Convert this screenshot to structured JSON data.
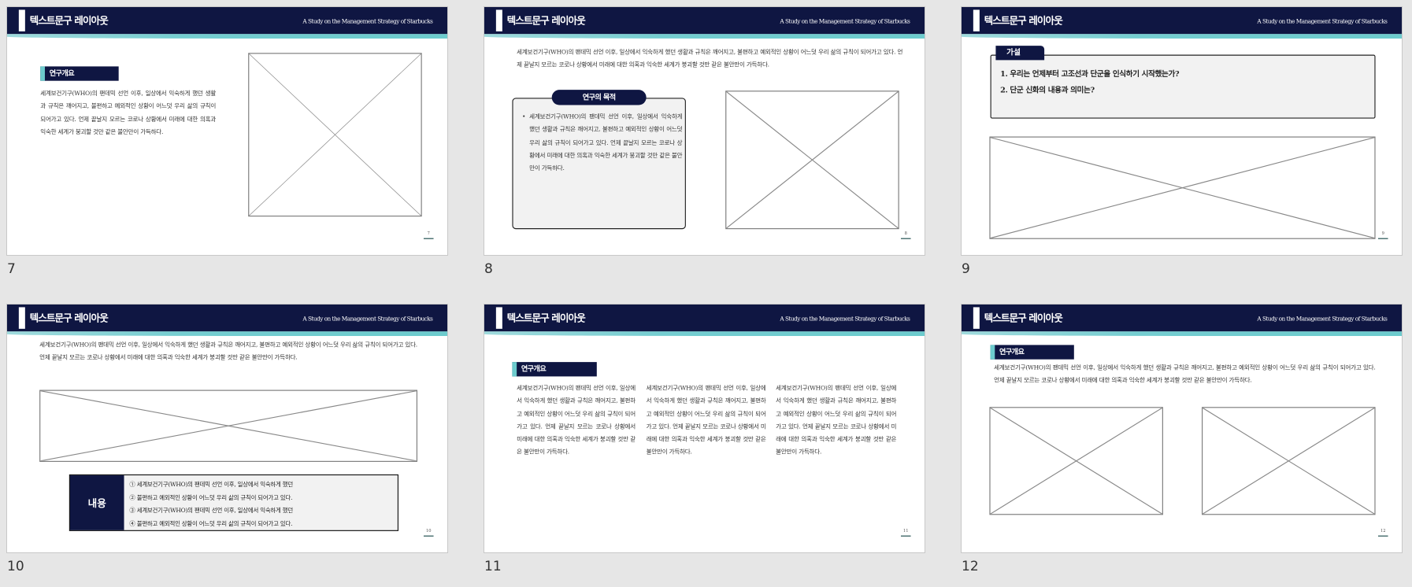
{
  "header": {
    "title": "텍스트문구 레이아웃",
    "subtitle": "A Study on the Management Strategy of Starbucks"
  },
  "slides": [
    {
      "number": "7",
      "page": "7",
      "label": "연구개요",
      "body": "세계보건기구(WHO)의 팬데믹 선언 이후, 일상에서 익숙하게 했던 생활과 규칙은 깨어지고, 불편하고 예외적인 상황이 어느덧 우리 삶의 규칙이 되어가고 있다. 언제 끝날지 모르는 코로나 상황에서 미래에 대한 의혹과 익숙한 세계가 붕괴할 것만 같은 불안만이 가득하다."
    },
    {
      "number": "8",
      "page": "8",
      "body": "세계보건기구(WHO)의 팬데믹 선언 이후, 일상에서 익숙하게 했던 생활과 규칙은 깨어지고, 불편하고 예외적인 상황이 어느덧 우리 삶의 규칙이 되어가고 있다. 언제 끝날지 모르는 코로나 상황에서 미래에 대한 의혹과 익숙한 세계가 붕괴할 것만 같은 불안만이 가득하다.",
      "box_title": "연구의 목적",
      "box_body": "세계보건기구(WHO)의 팬데믹 선언 이후, 일상에서 익숙하게 했던 생활과 규칙은 깨어지고, 불편하고 예외적인 상황이 어느덧 우리 삶의 규칙이 되어가고 있다. 언제 끝날지 모르는 코로나 상황에서 미래에 대한 의혹과 익숙한 세계가 붕괴할 것만 같은 불안만이 가득하다."
    },
    {
      "number": "9",
      "page": "9",
      "tab": "가설",
      "lines": [
        "1. 우리는 언제부터 고조선과 단군을 인식하기 시작했는가?",
        "2. 단군 신화의 내용과 의미는?"
      ]
    },
    {
      "number": "10",
      "page": "10",
      "body": "세계보건기구(WHO)의 팬데믹 선언 이후, 일상에서 익숙하게 했던 생활과 규칙은 깨어지고, 불편하고 예외적인 상황이 어느덧 우리 삶의 규칙이 되어가고 있다. 언제 끝날지 모르는 코로나 상황에서 미래에 대한 의혹과 익숙한 세계가 붕괴할 것만 같은 불안만이 가득하다.",
      "content_label": "내용",
      "items": [
        "①  세계보건기구(WHO)의 팬데믹 선언 이후, 일상에서 익숙하게 했던",
        "②  불편하고 예외적인 상황이 어느덧 우리 삶의 규칙이 되어가고 있다.",
        "③  세계보건기구(WHO)의 팬데믹 선언 이후, 일상에서 익숙하게 했던",
        "④  불편하고 예외적인 상황이 어느덧 우리 삶의 규칙이 되어가고 있다."
      ]
    },
    {
      "number": "11",
      "page": "11",
      "label": "연구개요",
      "columns": [
        "세계보건기구(WHO)의 팬데믹 선언 이후, 일상에서 익숙하게 했던 생활과 규칙은 깨어지고, 불편하고 예외적인 상황이 어느덧 우리 삶의 규칙이 되어가고 있다. 언제 끝날지 모르는 코로나 상황에서 미래에 대한 의혹과 익숙한 세계가 붕괴할 것만 같은 불안만이 가득하다.",
        "세계보건기구(WHO)의 팬데믹 선언 이후, 일상에서 익숙하게 했던 생활과 규칙은 깨어지고, 불편하고 예외적인 상황이 어느덧 우리 삶의 규칙이 되어가고 있다. 언제 끝날지 모르는 코로나 상황에서 미래에 대한 의혹과 익숙한 세계가 붕괴할 것만 같은 불안만이 가득하다.",
        "세계보건기구(WHO)의 팬데믹 선언 이후, 일상에서 익숙하게 했던 생활과 규칙은 깨어지고, 불편하고 예외적인 상황이 어느덧 우리 삶의 규칙이 되어가고 있다. 언제 끝날지 모르는 코로나 상황에서 미래에 대한 의혹과 익숙한 세계가 붕괴할 것만 같은 불안만이 가득하다."
      ]
    },
    {
      "number": "12",
      "page": "12",
      "label": "연구개요",
      "body": "세계보건기구(WHO)의 팬데믹 선언 이후, 일상에서 익숙하게 했던 생활과 규칙은 깨어지고, 불편하고 예외적인 상황이 어느덧 우리 삶의 규칙이 되어가고 있다. 언제 끝날지 모르는 코로나 상황에서 미래에 대한 의혹과 익숙한 세계가 붕괴할 것만 같은 불안만이 가득하다."
    }
  ],
  "colors": {
    "navy": "#0f1642",
    "teal": "#6ccbcd",
    "background": "#e6e6e6"
  }
}
